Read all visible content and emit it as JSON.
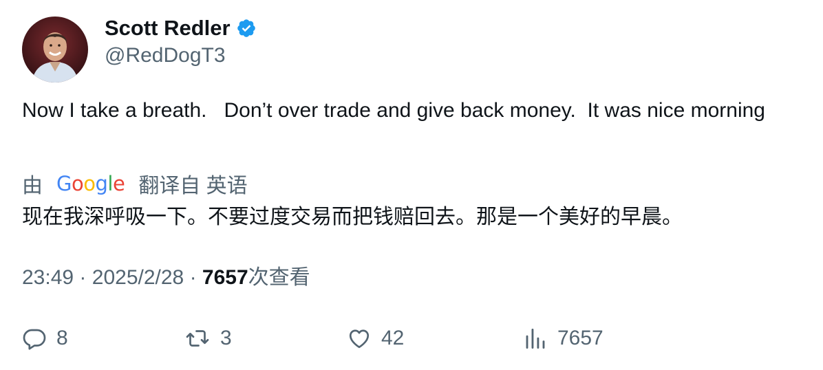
{
  "author": {
    "name": "Scott Redler",
    "handle": "@RedDogT3",
    "verified_color": "#1d9bf0"
  },
  "tweet": {
    "text": "Now I take a breath.   Don’t over trade and give back money.  It was nice morning"
  },
  "translation": {
    "by_label": "由",
    "provider": "Google",
    "from_label": "翻译自 英语",
    "text": "现在我深呼吸一下。不要过度交易而把钱赔回去。那是一个美好的早晨。"
  },
  "meta": {
    "time": "23:49",
    "separator": "·",
    "date": "2025/2/28",
    "views_count": "7657",
    "views_label": "次查看"
  },
  "actions": {
    "reply_count": "8",
    "retweet_count": "3",
    "like_count": "42",
    "views_count": "7657"
  },
  "icons": {
    "reply": "reply-icon",
    "retweet": "retweet-icon",
    "like": "heart-icon",
    "views": "views-icon",
    "verified": "verified-badge-icon"
  }
}
